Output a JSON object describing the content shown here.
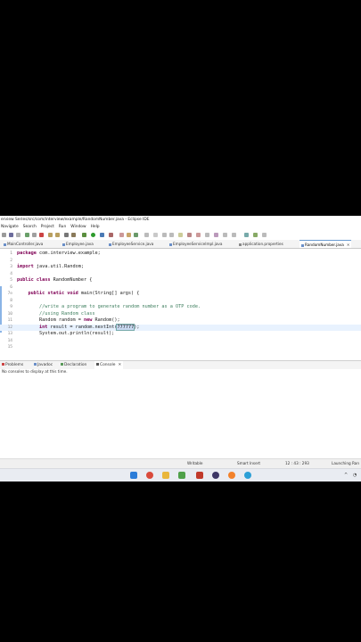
{
  "window": {
    "title": "erview Series/src/com/interview/example/RandomNumber.java - Eclipse IDE"
  },
  "menubar": [
    "Navigate",
    "Search",
    "Project",
    "Run",
    "Window",
    "Help"
  ],
  "tabs": [
    {
      "label": "MainController.java"
    },
    {
      "label": "Employee.java"
    },
    {
      "label": "EmployeeService.java"
    },
    {
      "label": "EmployeeServiceImpl.java"
    },
    {
      "label": "application.properties"
    },
    {
      "label": "RandomNumber.java"
    }
  ],
  "editor": {
    "lines": [
      {
        "num": "1",
        "code": "package com.interview.example;"
      },
      {
        "num": "2",
        "code": ""
      },
      {
        "num": "3",
        "code": "import java.util.Random;"
      },
      {
        "num": "4",
        "code": ""
      },
      {
        "num": "5",
        "code": "public class RandomNumber {"
      },
      {
        "num": "6",
        "code": ""
      },
      {
        "num": "7⊖",
        "code": "    public static void main(String[] args) {"
      },
      {
        "num": "8",
        "code": ""
      },
      {
        "num": "9",
        "code": "        //write a program to generate random number as a OTP code."
      },
      {
        "num": "10",
        "code": "        //using Random class"
      },
      {
        "num": "11",
        "code": "        Random random = new Random();"
      },
      {
        "num": "12",
        "code": "        int result = random.nextInt(777777);"
      },
      {
        "num": "13",
        "code": "        System.out.println(result);"
      },
      {
        "num": "14",
        "code": ""
      },
      {
        "num": "15",
        "code": ""
      }
    ]
  },
  "panel": {
    "tabs": [
      "Problems",
      "Javadoc",
      "Declaration",
      "Console"
    ],
    "message": "No consoles to display at this time."
  },
  "status": {
    "writable": "Writable",
    "insert_mode": "Smart Insert",
    "position": "12 : 43 : 293",
    "launching": "Launching Ran"
  },
  "colors": {
    "keyword": "#7f0055",
    "comment": "#3f7f5f",
    "current_line": "#e8f2fe"
  }
}
